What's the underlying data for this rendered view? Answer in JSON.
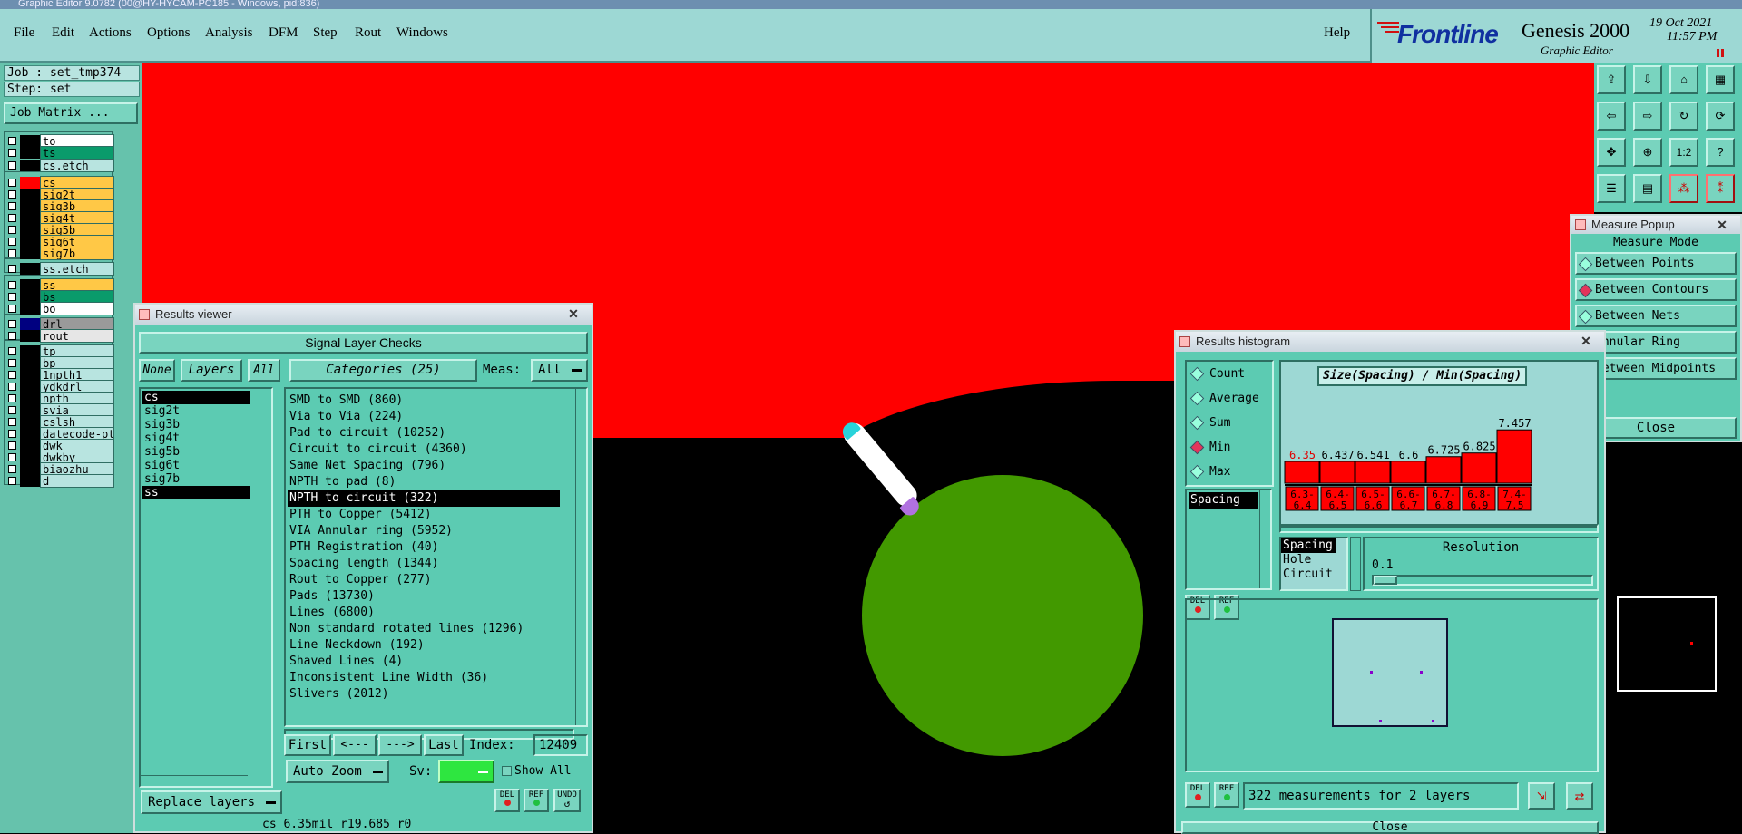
{
  "window_title": "Graphic Editor 9.0782 (00@HY-HYCAM-PC185 - Windows, pid:836)",
  "menu": {
    "items": [
      "File",
      "Edit",
      "Actions",
      "Options",
      "Analysis",
      "DFM",
      "Step",
      "Rout",
      "Windows"
    ],
    "help": "Help"
  },
  "brand": {
    "logo": "Frontline",
    "product": "Genesis 2000",
    "subtitle": "Graphic Editor",
    "date": "19 Oct 2021",
    "time": "11:57 PM"
  },
  "job": {
    "job_label": "Job : set_tmp374",
    "step_label": "Step: set",
    "matrix_button": "Job Matrix ..."
  },
  "layers": [
    {
      "name": "to",
      "color": "#ffffff"
    },
    {
      "name": "ts",
      "color": "#0a9b6b"
    },
    {
      "name": "cs.etch",
      "color": "#b8e4e0"
    },
    {
      "name": "cs",
      "color": "#ffc846",
      "swatch": "#ff0000"
    },
    {
      "name": "sig2t",
      "color": "#ffc846"
    },
    {
      "name": "sig3b",
      "color": "#ffc846"
    },
    {
      "name": "sig4t",
      "color": "#ffc846"
    },
    {
      "name": "sig5b",
      "color": "#ffc846"
    },
    {
      "name": "sig6t",
      "color": "#ffc846"
    },
    {
      "name": "sig7b",
      "color": "#ffc846"
    },
    {
      "name": "ss.etch",
      "color": "#b8e4e0"
    },
    {
      "name": "ss",
      "color": "#ffc846"
    },
    {
      "name": "bs",
      "color": "#0a9b6b"
    },
    {
      "name": "bo",
      "color": "#ffffff"
    },
    {
      "name": "drl",
      "color": "#9a9a9a",
      "swatch": "#000080"
    },
    {
      "name": "rout",
      "color": "#e6e6e6"
    },
    {
      "name": "tp",
      "color": "#b8e4e0"
    },
    {
      "name": "bp",
      "color": "#b8e4e0"
    },
    {
      "name": "1npth1",
      "color": "#b8e4e0"
    },
    {
      "name": "ydkdrl",
      "color": "#b8e4e0"
    },
    {
      "name": "npth",
      "color": "#b8e4e0"
    },
    {
      "name": "svia",
      "color": "#b8e4e0"
    },
    {
      "name": "cslsh",
      "color": "#b8e4e0"
    },
    {
      "name": "datecode-pt",
      "color": "#b8e4e0"
    },
    {
      "name": "dwk",
      "color": "#b8e4e0"
    },
    {
      "name": "dwkby",
      "color": "#b8e4e0"
    },
    {
      "name": "biaozhu",
      "color": "#b8e4e0"
    },
    {
      "name": "d",
      "color": "#b8e4e0"
    }
  ],
  "results_viewer": {
    "title": "Results viewer",
    "header": "Signal Layer Checks",
    "none_btn": "None",
    "layers_btn": "Layers",
    "all_btn": "All",
    "categories_btn": "Categories (25)",
    "meas_label": "Meas:",
    "meas_value": "All",
    "layer_list": [
      "cs",
      "sig2t",
      "sig3b",
      "sig4t",
      "sig5b",
      "sig6t",
      "sig7b",
      "ss"
    ],
    "categories": [
      "SMD to SMD (860)",
      "Via to Via (224)",
      "Pad to circuit (10252)",
      "Circuit to circuit (4360)",
      "Same Net Spacing (796)",
      "NPTH to pad (8)",
      "NPTH to circuit (322)",
      "PTH to Copper (5412)",
      "VIA Annular ring (5952)",
      "PTH Registration (40)",
      "Spacing length (1344)",
      "Rout to Copper (277)",
      "Pads (13730)",
      "Lines (6800)",
      "Non standard rotated lines (1296)",
      "Line Neckdown (192)",
      "Shaved Lines (4)",
      "Inconsistent Line Width (36)",
      "Slivers (2012)"
    ],
    "first_btn": "First",
    "prev_btn": "<---",
    "next_btn": "--->",
    "last_btn": "Last",
    "index_label": "Index:",
    "index_value": "12409",
    "auto_zoom": "Auto Zoom",
    "sv_label": "Sv:",
    "show_all": "Show All",
    "replace_layers": "Replace layers",
    "del_btn": "DEL",
    "ref_btn": "REF",
    "undo_btn": "UNDO",
    "status": "cs 6.35mil r19.685 r0"
  },
  "measure_popup": {
    "title": "Measure Popup",
    "mode_label": "Measure Mode",
    "modes": [
      "Between Points",
      "Between Contours",
      "Between Nets",
      "Annular Ring",
      "Between Midpoints"
    ],
    "close_btn": "Close"
  },
  "histogram": {
    "title": "Results histogram",
    "stats": [
      "Count",
      "Average",
      "Sum",
      "Min",
      "Max"
    ],
    "active_stat": "Min",
    "list_item": "Spacing",
    "chart_title": "Size(Spacing) / Min(Spacing)",
    "types": [
      "Spacing",
      "Hole",
      "Circuit"
    ],
    "resolution_label": "Resolution",
    "resolution_value": "0.1",
    "status": "322 measurements for 2 layers",
    "del_btn": "DEL",
    "ref_btn": "REF",
    "close_btn": "Close"
  },
  "chart_data": {
    "type": "bar",
    "title": "Size(Spacing) / Min(Spacing)",
    "categories": [
      "6.3-6.4",
      "6.4-6.5",
      "6.5-6.6",
      "6.6-6.7",
      "6.7-6.8",
      "6.8-6.9",
      "7.4-7.5"
    ],
    "values": [
      6.35,
      6.437,
      6.541,
      6.6,
      6.725,
      6.825,
      7.457
    ],
    "bar_color": "#ff0000",
    "highlight_color": "#ff0000"
  },
  "colors": {
    "copper_red": "#ff0000",
    "pad_green": "#429900",
    "panel_teal": "#5ccbb2",
    "menubar": "#9dd8d4"
  }
}
